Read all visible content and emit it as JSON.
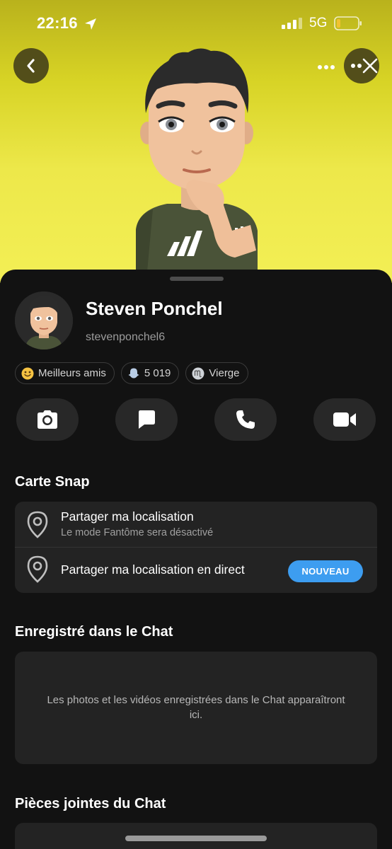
{
  "status_bar": {
    "time": "22:16",
    "network": "5G"
  },
  "header": {
    "back_icon": "chevron-left-icon",
    "more_icon": "more-horizontal-icon",
    "close_icon": "close-icon",
    "background_color": "#e6e23a"
  },
  "profile": {
    "display_name": "Steven Ponchel",
    "username": "stevenponchel6",
    "chips": [
      {
        "icon": "smiley-icon",
        "label": "Meilleurs amis"
      },
      {
        "icon": "snap-score-ghost-icon",
        "label": "5 019"
      },
      {
        "icon": "virgo-zodiac-icon",
        "label": "Vierge"
      }
    ]
  },
  "actions": [
    {
      "name": "camera",
      "icon": "camera-icon"
    },
    {
      "name": "chat",
      "icon": "chat-bubble-icon"
    },
    {
      "name": "call",
      "icon": "phone-icon"
    },
    {
      "name": "video",
      "icon": "video-camera-icon"
    }
  ],
  "snap_map": {
    "title": "Carte Snap",
    "share_location": "Partager ma localisation",
    "share_location_sub": "Le mode Fantôme sera désactivé",
    "share_live": "Partager ma localisation en direct",
    "new_badge": "NOUVEAU"
  },
  "saved_in_chat": {
    "title": "Enregistré dans le Chat",
    "empty_text": "Les photos et les vidéos enregistrées dans le Chat apparaîtront ici."
  },
  "chat_attachments": {
    "title": "Pièces jointes du Chat"
  },
  "colors": {
    "accent_blue": "#3d9df0",
    "surface": "#232323",
    "background": "#121212"
  }
}
